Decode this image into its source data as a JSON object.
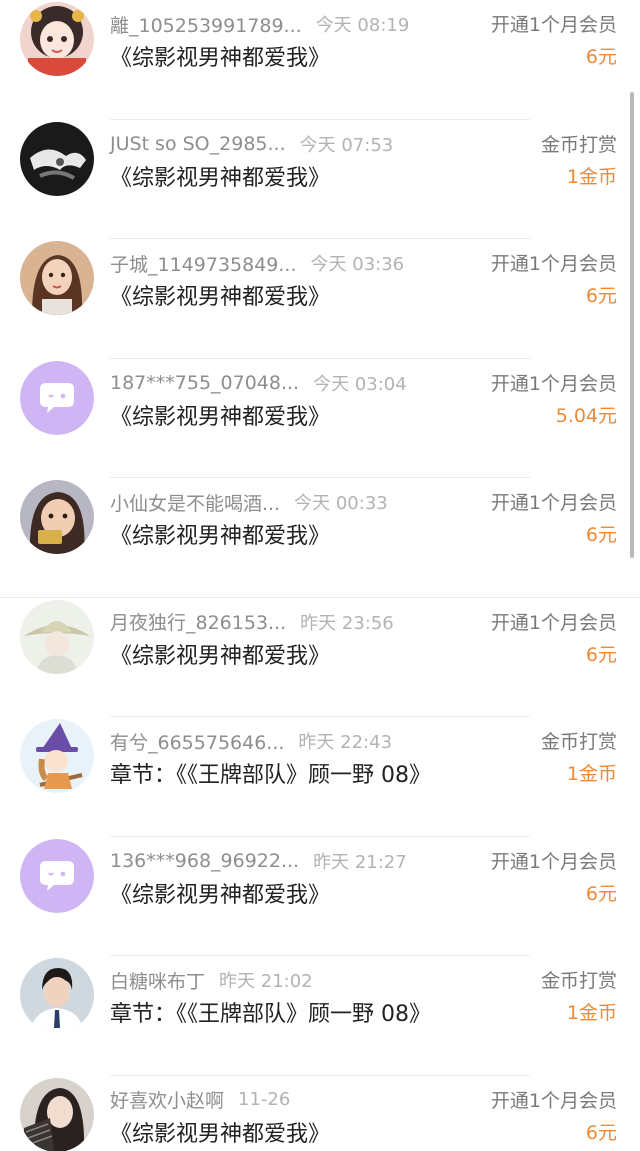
{
  "records": [
    {
      "user": "離_105253991789...",
      "time": "今天 08:19",
      "title": "《综影视男神都爱我》",
      "type": "开通1个月会员",
      "amount": "6元",
      "avatar": "avatar-illustrated-girl-icon"
    },
    {
      "user": "JUSt so SO_2985...",
      "time": "今天 07:53",
      "title": "《综影视男神都爱我》",
      "type": "金币打赏",
      "amount": "1金币",
      "avatar": "avatar-bw-photo-icon"
    },
    {
      "user": "子城_1149735849...",
      "time": "今天 03:36",
      "title": "《综影视男神都爱我》",
      "type": "开通1个月会员",
      "amount": "6元",
      "avatar": "avatar-painted-woman-icon"
    },
    {
      "user": "187***755_07048...",
      "time": "今天 03:04",
      "title": "《综影视男神都爱我》",
      "type": "开通1个月会员",
      "amount": "5.04元",
      "avatar": "default-chat-avatar-icon"
    },
    {
      "user": "小仙女是不能喝酒...",
      "time": "今天 00:33",
      "title": "《综影视男神都爱我》",
      "type": "开通1个月会员",
      "amount": "6元",
      "avatar": "avatar-child-photo-icon"
    },
    {
      "user": "月夜独行_826153...",
      "time": "昨天 23:56",
      "title": "《综影视男神都爱我》",
      "type": "开通1个月会员",
      "amount": "6元",
      "avatar": "avatar-hat-figure-icon"
    },
    {
      "user": "有兮_665575646...",
      "time": "昨天 22:43",
      "title": "章节：《《王牌部队》顾一野 08》",
      "type": "金币打赏",
      "amount": "1金币",
      "avatar": "avatar-witch-cartoon-icon"
    },
    {
      "user": "136***968_96922...",
      "time": "昨天 21:27",
      "title": "《综影视男神都爱我》",
      "type": "开通1个月会员",
      "amount": "6元",
      "avatar": "default-chat-avatar-icon"
    },
    {
      "user": "白糖咪布丁",
      "time": "昨天 21:02",
      "title": "章节：《《王牌部队》顾一野 08》",
      "type": "金币打赏",
      "amount": "1金币",
      "avatar": "avatar-man-suit-icon"
    },
    {
      "user": "好喜欢小赵啊",
      "time": "11-26",
      "title": "《综影视男神都爱我》",
      "type": "开通1个月会员",
      "amount": "6元",
      "avatar": "avatar-woman-photo-icon"
    }
  ],
  "colors": {
    "amount": "#ee8936",
    "name": "#8e8e8e",
    "time": "#b3b3b3",
    "title": "#222222",
    "default_avatar": "#cfb5f3"
  }
}
